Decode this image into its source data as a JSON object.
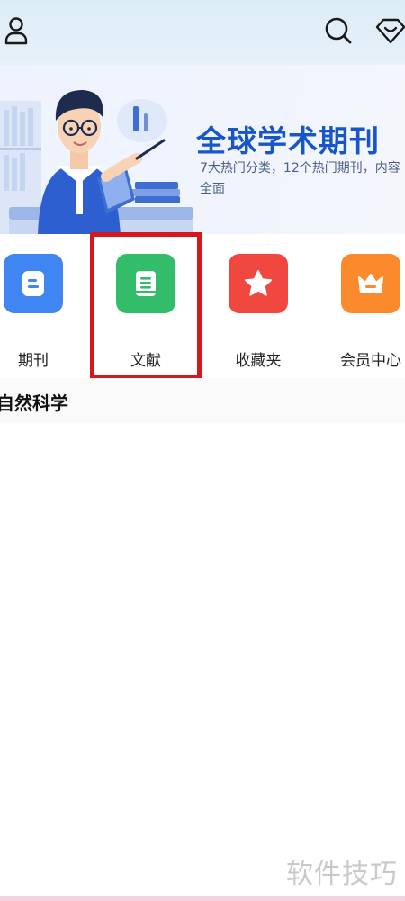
{
  "header": {
    "profile_icon": "person-icon",
    "search_icon": "search-icon",
    "vip_icon": "diamond-heart-icon"
  },
  "banner": {
    "title": "全球学术期刊",
    "subtitle": "7大热门分类，12个热门期刊，内容全面"
  },
  "shortcuts": [
    {
      "label": "期刊",
      "icon": "document-icon",
      "color": "#3f86f2"
    },
    {
      "label": "文献",
      "icon": "book-icon",
      "color": "#33bd6b"
    },
    {
      "label": "收藏夹",
      "icon": "star-icon",
      "color": "#f0483f"
    },
    {
      "label": "会员中心",
      "icon": "crown-icon",
      "color": "#fb8a2c"
    }
  ],
  "section": {
    "title": "自然科学"
  },
  "watermark": "软件技巧",
  "colors": {
    "accent": "#1756c9",
    "highlight": "#d7171c"
  }
}
